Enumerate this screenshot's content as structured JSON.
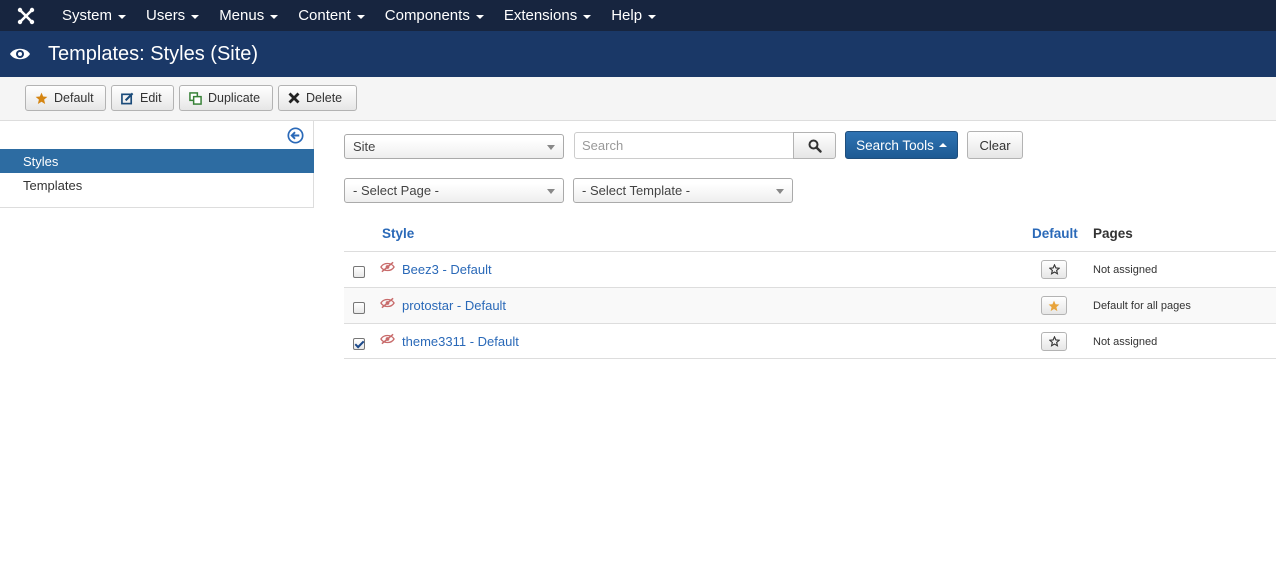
{
  "nav": {
    "logo_icon": "joomla-logo-icon",
    "items": [
      {
        "label": "System"
      },
      {
        "label": "Users"
      },
      {
        "label": "Menus"
      },
      {
        "label": "Content"
      },
      {
        "label": "Components"
      },
      {
        "label": "Extensions"
      },
      {
        "label": "Help"
      }
    ]
  },
  "header": {
    "icon": "eye-icon",
    "title": "Templates: Styles (Site)"
  },
  "toolbar": {
    "default_label": "Default",
    "edit_label": "Edit",
    "duplicate_label": "Duplicate",
    "delete_label": "Delete"
  },
  "sidebar": {
    "items": [
      {
        "label": "Styles",
        "active": true
      },
      {
        "label": "Templates",
        "active": false
      }
    ]
  },
  "filters": {
    "client_select": "Site",
    "search_placeholder": "Search",
    "search_tools_label": "Search Tools",
    "clear_label": "Clear",
    "page_select": "- Select Page -",
    "template_select": "- Select Template -"
  },
  "table": {
    "headers": {
      "style": "Style",
      "default": "Default",
      "pages": "Pages"
    },
    "rows": [
      {
        "name": "Beez3 - Default",
        "checked": false,
        "is_default": false,
        "pages": "Not assigned"
      },
      {
        "name": "protostar - Default",
        "checked": false,
        "is_default": true,
        "pages": "Default for all pages"
      },
      {
        "name": "theme3311 - Default",
        "checked": true,
        "is_default": false,
        "pages": "Not assigned"
      }
    ]
  },
  "colors": {
    "topnav_bg": "#17253f",
    "header_bg": "#1a3867",
    "accent": "#2d6ca2",
    "link": "#2a69b8",
    "default_star": "#e8a33a"
  }
}
